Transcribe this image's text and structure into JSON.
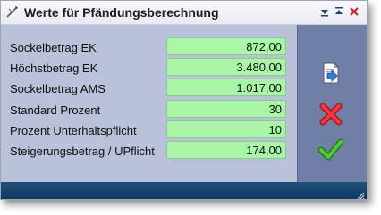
{
  "window": {
    "title": "Werte für Pfändungsberechnung",
    "title_icon": "calculator-pen-icon"
  },
  "titlebar_buttons": [
    {
      "name": "minimize-button",
      "icon": "minimize-icon"
    },
    {
      "name": "restore-button",
      "icon": "restore-icon"
    },
    {
      "name": "close-button",
      "icon": "close-icon"
    }
  ],
  "fields": [
    {
      "label": "Sockelbetrag EK",
      "value": "872,00"
    },
    {
      "label": "Höchstbetrag EK",
      "value": "3.480,00"
    },
    {
      "label": "Sockelbetrag AMS",
      "value": "1.017,00"
    },
    {
      "label": "Standard Prozent",
      "value": "30"
    },
    {
      "label": "Prozent Unterhaltspflicht",
      "value": "10"
    },
    {
      "label": "Steigerungsbetrag / UPflicht",
      "value": "174,00"
    }
  ],
  "side_actions": [
    {
      "name": "export-button",
      "icon": "export-document-icon"
    },
    {
      "name": "cancel-button",
      "icon": "red-x-icon"
    },
    {
      "name": "confirm-button",
      "icon": "green-check-icon"
    }
  ],
  "colors": {
    "field_bg": "#a9f7a6",
    "content_bg": "#b9c2d8",
    "side_panel_bg": "#6f7fa5",
    "status_bar_bg": "#1a4670",
    "close_red": "#d0202a"
  }
}
